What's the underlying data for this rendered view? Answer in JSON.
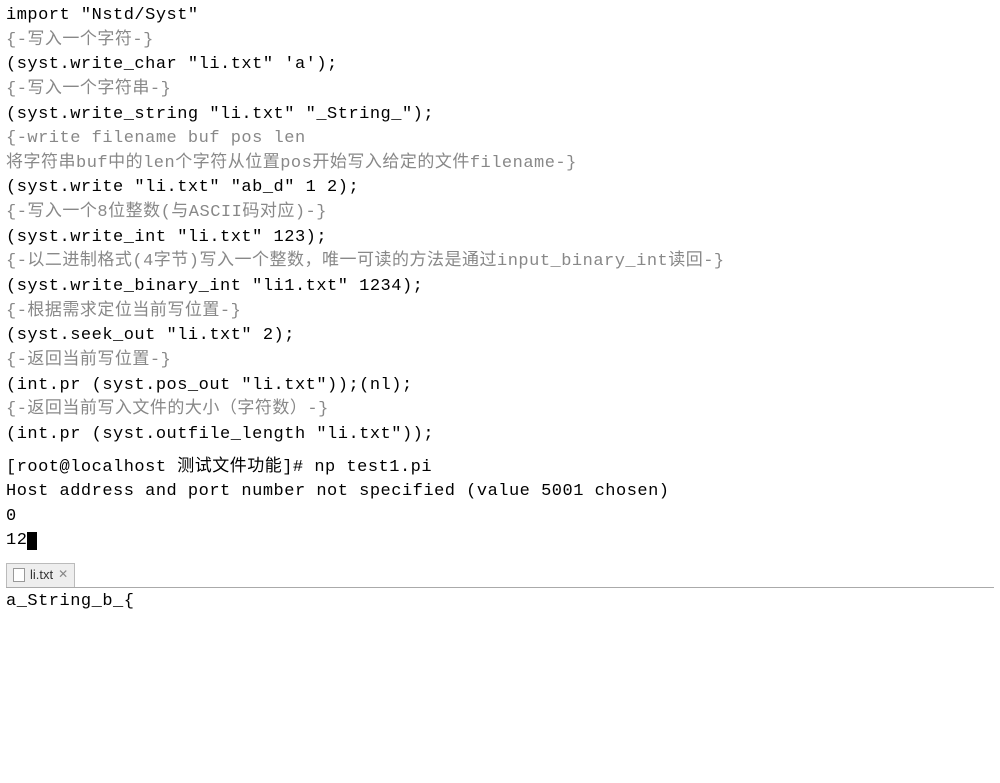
{
  "code": {
    "l1": "import \"Nstd/Syst\"",
    "c1": "{-写入一个字符-}",
    "l2": "(syst.write_char \"li.txt\" 'a');",
    "c2": "{-写入一个字符串-}",
    "l3": "(syst.write_string \"li.txt\" \"_String_\");",
    "c3a": "{-write filename buf pos len",
    "c3b": "将字符串buf中的len个字符从位置pos开始写入给定的文件filename-}",
    "l4": "(syst.write \"li.txt\" \"ab_d\" 1 2);",
    "c4": "{-写入一个8位整数(与ASCII码对应)-}",
    "l5": "(syst.write_int \"li.txt\" 123);",
    "c5": "{-以二进制格式(4字节)写入一个整数，唯一可读的方法是通过input_binary_int读回-}",
    "l6": "(syst.write_binary_int \"li1.txt\" 1234);",
    "c6": "{-根据需求定位当前写位置-}",
    "l7": "(syst.seek_out \"li.txt\" 2);",
    "c7": "{-返回当前写位置-}",
    "l8": "(int.pr (syst.pos_out \"li.txt\"));(nl);",
    "c8": "{-返回当前写入文件的大小（字符数）-}",
    "l9": "(int.pr (syst.outfile_length \"li.txt\"));"
  },
  "terminal": {
    "prompt": "[root@localhost 测试文件功能]# np test1.pi",
    "out1": "Host address and port number not specified (value 5001 chosen)",
    "out2": "0",
    "out3": "12"
  },
  "tab": {
    "filename": "li.txt"
  },
  "file": {
    "content": "a_String_b_{"
  }
}
